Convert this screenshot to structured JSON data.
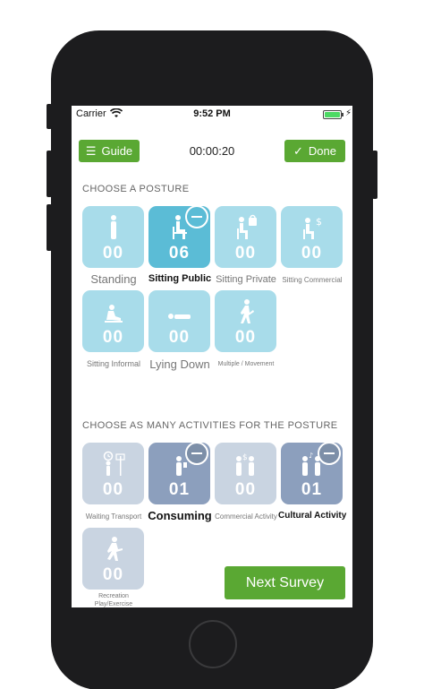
{
  "status_bar": {
    "carrier": "Carrier",
    "time": "9:52 PM"
  },
  "header": {
    "guide_label": "Guide",
    "timer": "00:00:20",
    "done_label": "Done"
  },
  "posture_section": {
    "title": "CHOOSE A POSTURE",
    "items": [
      {
        "label": "Standing",
        "count": "00",
        "selected": false,
        "icon": "standing-person-icon"
      },
      {
        "label": "Sitting Public",
        "count": "06",
        "selected": true,
        "icon": "sitting-person-icon"
      },
      {
        "label": "Sitting Private",
        "count": "00",
        "selected": false,
        "icon": "sitting-private-icon"
      },
      {
        "label": "Sitting Commercial",
        "count": "00",
        "selected": false,
        "icon": "sitting-commercial-icon"
      },
      {
        "label": "Sitting Informal",
        "count": "00",
        "selected": false,
        "icon": "sitting-informal-icon"
      },
      {
        "label": "Lying Down",
        "count": "00",
        "selected": false,
        "icon": "lying-down-icon"
      },
      {
        "label": "Multiple / Movement",
        "count": "00",
        "selected": false,
        "icon": "walking-person-icon"
      }
    ]
  },
  "activity_section": {
    "title": "CHOOSE AS MANY ACTIVITIES FOR THE POSTURE",
    "items": [
      {
        "label": "Waiting Transport",
        "count": "00",
        "selected": false,
        "icon": "bus-stop-icon"
      },
      {
        "label": "Consuming",
        "count": "01",
        "selected": true,
        "icon": "consuming-icon"
      },
      {
        "label": "Commercial Activity",
        "count": "00",
        "selected": false,
        "icon": "commercial-activity-icon"
      },
      {
        "label": "Cultural Activity",
        "count": "01",
        "selected": true,
        "icon": "cultural-activity-icon"
      },
      {
        "label": "Recreation",
        "label2": "Play/Exercise",
        "count": "00",
        "selected": false,
        "icon": "running-person-icon"
      }
    ]
  },
  "next_button": {
    "label": "Next Survey"
  },
  "colors": {
    "green": "#5aa833",
    "posture_tile": "#a8dcea",
    "posture_selected": "#5bbcd6",
    "activity_tile": "#c9d4e1",
    "activity_selected": "#8c9fbd"
  }
}
